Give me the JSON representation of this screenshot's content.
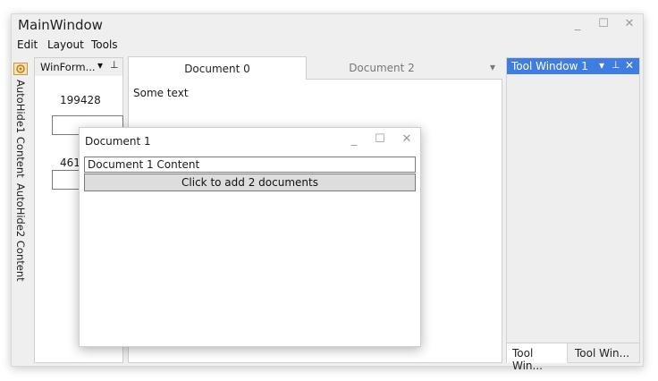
{
  "window": {
    "title": "MainWindow",
    "minimize_glyph": "_",
    "maximize_glyph": "☐",
    "close_glyph": "✕"
  },
  "menu": [
    "Edit",
    "Layout",
    "Tools"
  ],
  "autohide": {
    "items": [
      "AutoHide1 Content",
      "AutoHide2 Content"
    ]
  },
  "winforms_panel": {
    "title": "WinForm...",
    "dropdown_glyph": "▾",
    "pin_glyph": "⊥",
    "value1": "199428",
    "value2": "461"
  },
  "document_tabs": {
    "tabs": [
      "Document 0",
      "Document 2"
    ],
    "active": "Document 0",
    "overflow_glyph": "▾",
    "content": "Some text"
  },
  "tool_window": {
    "title": "Tool Window 1",
    "dropdown_glyph": "▾",
    "pin_glyph": "⊥",
    "close_glyph": "✕",
    "bottom_tabs": [
      "Tool Win...",
      "Tool Win..."
    ]
  },
  "floating_document": {
    "title": "Document 1",
    "minimize_glyph": "_",
    "maximize_glyph": "☐",
    "close_glyph": "✕",
    "textbox_value": "Document 1 Content",
    "button_label": "Click to add 2 documents"
  },
  "colors": {
    "accent": "#3f7ee0",
    "window_bg": "#efefef",
    "content_bg": "#ffffff"
  }
}
